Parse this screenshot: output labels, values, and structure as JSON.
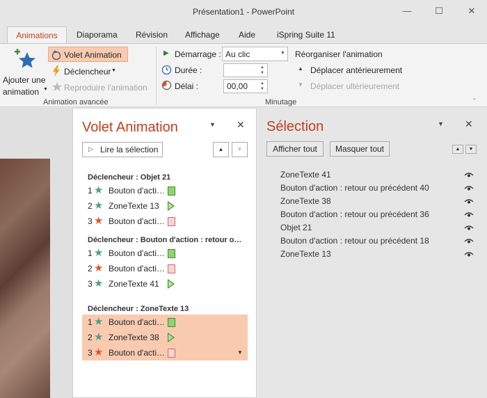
{
  "window": {
    "title": "Présentation1  -  PowerPoint"
  },
  "tabs": [
    "Animations",
    "Diaporama",
    "Révision",
    "Affichage",
    "Aide",
    "iSpring Suite 11"
  ],
  "ribbon": {
    "add_animation_line1": "Ajouter une",
    "add_animation_line2": "animation",
    "anim_pane": "Volet Animation",
    "trigger": "Déclencheur",
    "reproduce": "Reproduire l'animation",
    "group_advanced": "Animation avancée",
    "start_label": "Démarrage :",
    "start_value": "Au clic",
    "duration_label": "Durée :",
    "duration_value": "",
    "delay_label": "Délai :",
    "delay_value": "00,00",
    "reorder": "Réorganiser l'animation",
    "move_earlier": "Déplacer antérieurement",
    "move_later": "Déplacer ultérieurement",
    "group_timing": "Minutage"
  },
  "anim_pane": {
    "title": "Volet Animation",
    "play_button": "Lire la sélection",
    "groups": [
      {
        "header": "Déclencheur : Objet 21",
        "items": [
          {
            "num": "1",
            "label": "Bouton d'acti…",
            "star": "green",
            "marker": "box-green"
          },
          {
            "num": "2",
            "label": "ZoneTexte 13",
            "star": "green",
            "marker": "triangle"
          },
          {
            "num": "3",
            "label": "Bouton d'acti…",
            "star": "red",
            "marker": "box-pink"
          }
        ]
      },
      {
        "header": "Déclencheur : Bouton d'action : retour o…",
        "items": [
          {
            "num": "1",
            "label": "Bouton d'acti…",
            "star": "green",
            "marker": "box-green"
          },
          {
            "num": "2",
            "label": "Bouton d'acti…",
            "star": "red",
            "marker": "box-pink"
          },
          {
            "num": "3",
            "label": "ZoneTexte 41",
            "star": "green",
            "marker": "triangle"
          }
        ]
      },
      {
        "header": "Déclencheur : ZoneTexte 13",
        "items": [
          {
            "num": "1",
            "label": "Bouton d'acti…",
            "star": "green",
            "marker": "box-green"
          },
          {
            "num": "2",
            "label": "ZoneTexte 38",
            "star": "green",
            "marker": "triangle"
          },
          {
            "num": "3",
            "label": "Bouton d'acti…",
            "star": "red",
            "marker": "box-pink"
          }
        ]
      }
    ]
  },
  "selection_pane": {
    "title": "Sélection",
    "show_all": "Afficher tout",
    "hide_all": "Masquer tout",
    "items": [
      "ZoneTexte 41",
      "Bouton d'action : retour ou précédent 40",
      "ZoneTexte 38",
      "Bouton d'action : retour ou précédent 36",
      "Objet 21",
      "Bouton d'action : retour ou précédent 18",
      "ZoneTexte 13"
    ]
  },
  "colors": {
    "accent": "#c43e1c",
    "green_star": "#4f9d8a",
    "red_star": "#d9572f",
    "selected_row": "#f8cbb1"
  }
}
